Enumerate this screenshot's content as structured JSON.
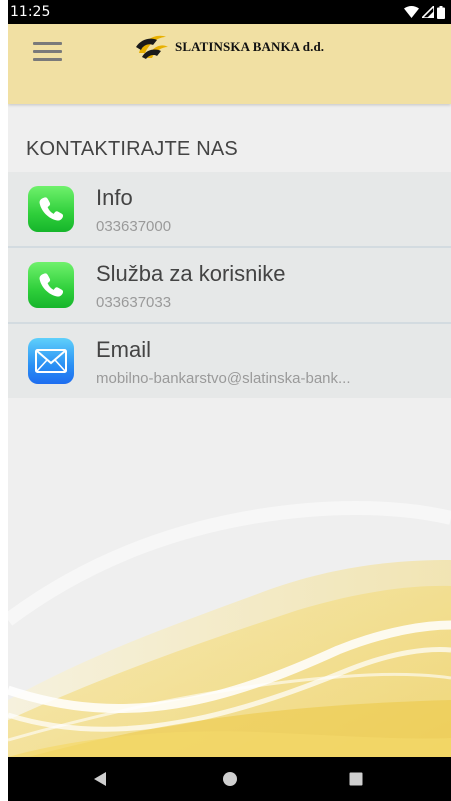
{
  "status_bar": {
    "time": "11:25",
    "icons": [
      "wifi-icon",
      "signal-icon",
      "battery-icon"
    ]
  },
  "app_bar": {
    "menu_icon": "hamburger-menu-icon",
    "brand": "SLATINSKA BANKA d.d."
  },
  "section": {
    "title": "KONTAKTIRAJTE NAS"
  },
  "contacts": [
    {
      "icon": "phone-icon",
      "title": "Info",
      "subtitle": "033637000"
    },
    {
      "icon": "phone-icon",
      "title": "Služba za korisnike",
      "subtitle": "033637033"
    },
    {
      "icon": "mail-icon",
      "title": "Email",
      "subtitle": "mobilno-bankarstvo@slatinska-bank..."
    }
  ],
  "nav_bar": {
    "buttons": [
      "back-icon",
      "home-icon",
      "recents-icon"
    ]
  },
  "colors": {
    "app_bar": "#f1e0a3",
    "background": "#efefef",
    "list_item": "#e6e8e8",
    "phone_icon": "#2fcf3b",
    "mail_icon": "#2a8ff4"
  }
}
